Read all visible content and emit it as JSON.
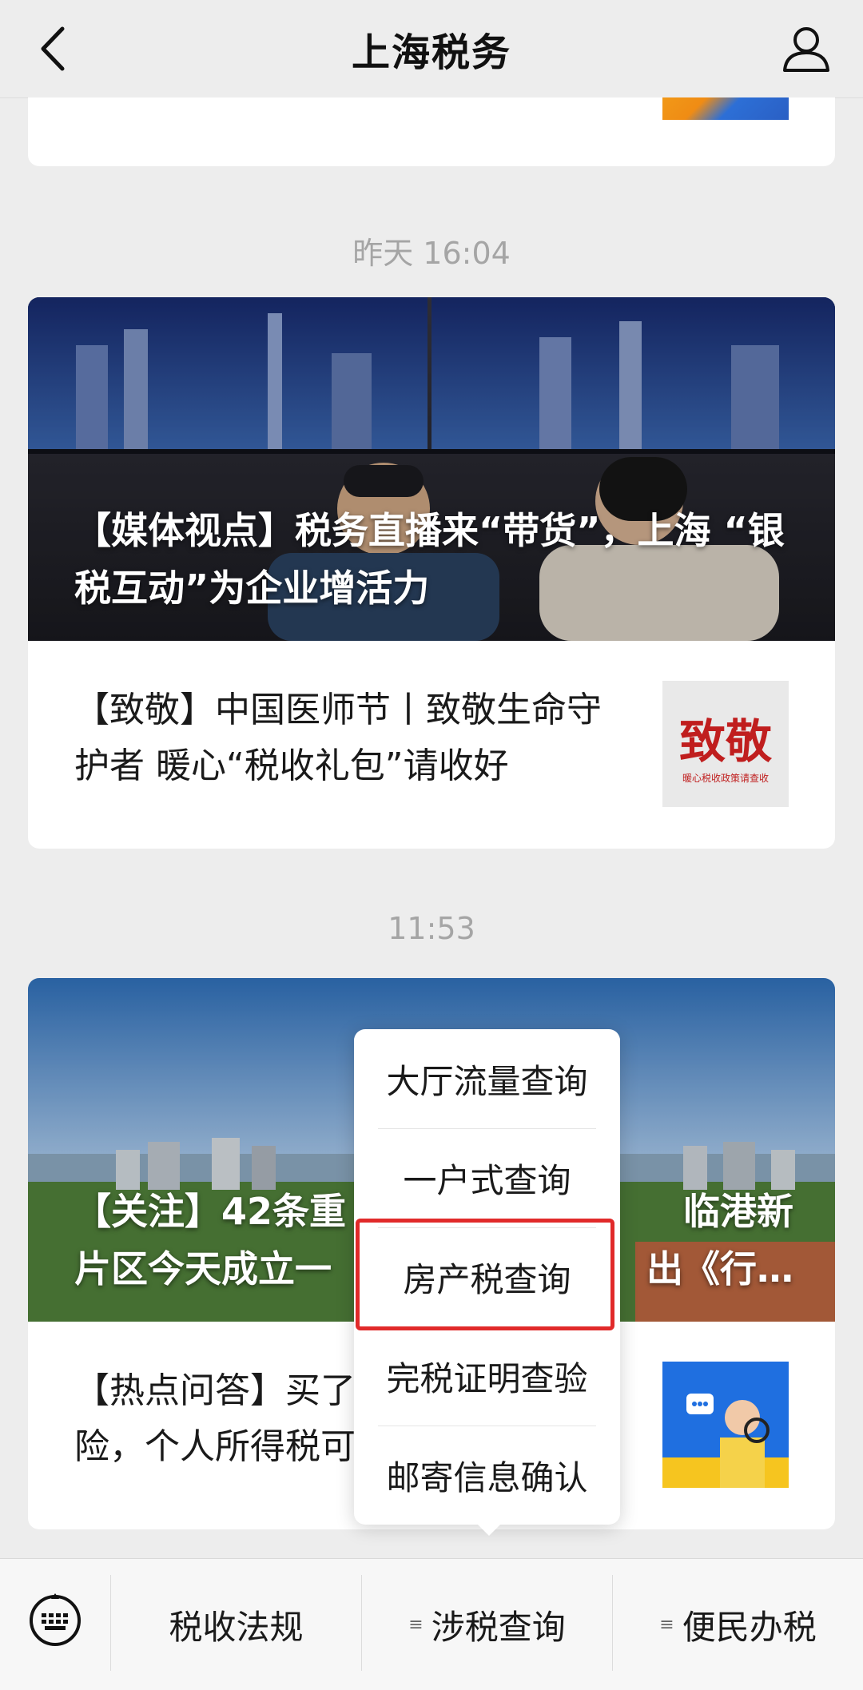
{
  "header": {
    "title": "上海税务"
  },
  "timestamps": {
    "t1": "昨天 16:04",
    "t2": "11:53"
  },
  "card1": {
    "hero_title": "【媒体视点】税务直播来“带货”，上海 “银税互动”为企业增活力",
    "item_title": "【致敬】中国医师节丨致敬生命守护者 暖心“税收礼包”请收好",
    "thumb_text": "致敬",
    "thumb_caption": "暖心税收政策请查收"
  },
  "card2": {
    "hero_title_left": "【关注】42条重",
    "hero_title_right": "临港新",
    "hero_title_line2_left": "片区今天成立一",
    "hero_title_line2_right": "出《行…",
    "item_title_left": "【热点问答】买了",
    "item_title_line2": "险，个人所得税可"
  },
  "popup_menu": {
    "items": [
      "大厅流量查询",
      "一户式查询",
      "房产税查询",
      "完税证明查验",
      "邮寄信息确认"
    ]
  },
  "bottom_menu": {
    "items": [
      "税收法规",
      "涉税查询",
      "便民办税"
    ]
  }
}
